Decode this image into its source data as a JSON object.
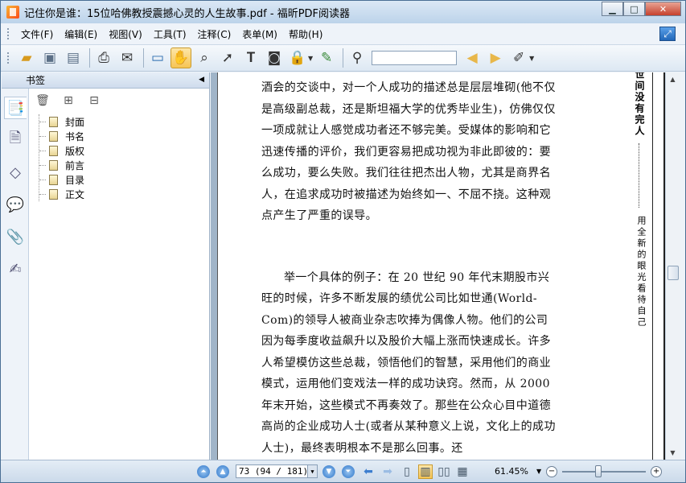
{
  "window": {
    "title": "记住你是谁：15位哈佛教授震撼心灵的人生故事.pdf - 福昕PDF阅读器",
    "minimize": "▁",
    "maximize": "□",
    "close": "✕"
  },
  "menu": {
    "items": [
      "文件(F)",
      "编辑(E)",
      "视图(V)",
      "工具(T)",
      "注释(C)",
      "表单(M)",
      "帮助(H)"
    ],
    "corner_icon": "expand-icon"
  },
  "toolbar": {
    "tools": [
      "open-icon",
      "save-icon",
      "save-as-icon",
      "print-icon",
      "email-icon",
      "fullscreen-icon",
      "hand-icon",
      "loupe-icon",
      "select-arrow-icon",
      "text-select-icon",
      "snapshot-icon",
      "rms-icon",
      "sign-icon",
      "find-icon",
      "prev-result-icon",
      "next-result-icon",
      "highlight-icon"
    ],
    "search_value": ""
  },
  "sidebar": {
    "header": "书签",
    "collapse_icon": "◀",
    "bookmarks": [
      "封面",
      "书名",
      "版权",
      "前言",
      "目录",
      "正文"
    ]
  },
  "page": {
    "paragraph1": "酒会的交谈中，对一个人成功的描述总是层层堆砌(他不仅是高级副总裁，还是斯坦福大学的优秀毕业生)，仿佛仅仅一项成就让人感觉成功者还不够完美。受媒体的影响和它迅速传播的评价，我们更容易把成功视为非此即彼的：要么成功，要么失败。我们往往把杰出人物，尤其是商界名人，在追求成功时被描述为始终如一、不屈不挠。这种观点产生了严重的误导。",
    "paragraph2": "举一个具体的例子：在 20 世纪 90 年代末期股市兴旺的时候，许多不断发展的绩优公司比如世通(World-Com)的领导人被商业杂志吹捧为偶像人物。他们的公司因为每季度收益飙升以及股价大幅上涨而快速成长。许多人希望模仿这些总裁，领悟他们的智慧，采用他们的商业模式，运用他们变戏法一样的成功诀窍。然而，从 2000 年末开始，这些模式不再奏效了。那些在公众心目中道德高尚的企业成功人士(或者从某种意义上说，文化上的成功人士)，最终表明根本不是那么回事。还",
    "vertical_title": "世间没有完人",
    "vertical_subtitle": "用全新的眼光看待自己"
  },
  "statusbar": {
    "page_value": "73 (94 / 181)",
    "zoom": "61.45%",
    "zoom_fraction": 0.43
  }
}
